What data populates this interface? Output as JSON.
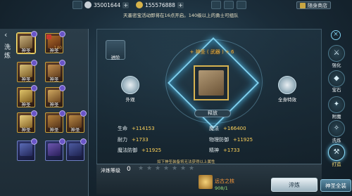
{
  "topbar": {
    "currency1": "35001644",
    "currency2": "155576888",
    "shop_label": "随身商店",
    "marquee": "天墨密宝活动即将在16点开启。140级以上的勇士可组队"
  },
  "left_panel": {
    "label": "洗炼",
    "items": [
      {
        "label": "神圣",
        "count": "",
        "type": "gold"
      },
      {
        "label": "神圣",
        "count": "140",
        "type": "gold"
      },
      {
        "label": "神圣",
        "count": "",
        "type": "gold"
      },
      {
        "label": "神圣",
        "count": "",
        "type": "gold"
      },
      {
        "label": "神圣",
        "count": "",
        "type": "gold"
      },
      {
        "label": "神圣",
        "count": "",
        "type": "gold"
      },
      {
        "label": "神圣",
        "count": "",
        "type": "gold"
      },
      {
        "label": "神圣",
        "count": "",
        "type": "gold"
      },
      {
        "label": "神圣",
        "count": "",
        "type": "gold"
      },
      {
        "label": "",
        "count": "",
        "type": "blue"
      },
      {
        "label": "",
        "count": "",
        "type": "blue"
      },
      {
        "label": "",
        "count": "",
        "type": "blue"
      }
    ]
  },
  "main": {
    "upgrade_label": "进阶",
    "title": "+ 神圣 ( 武器 ) + 6",
    "appearance_label": "外观",
    "fullbody_label": "全身特效",
    "release_label": "释放",
    "stats": [
      {
        "name": "生命",
        "value": "+114153"
      },
      {
        "name": "魔法",
        "value": "+166400"
      },
      {
        "name": "耐力",
        "value": "+1733"
      },
      {
        "name": "物理防御",
        "value": "+11925"
      },
      {
        "name": "魔法防御",
        "value": "+11925"
      },
      {
        "name": "精神",
        "value": "+1733"
      }
    ],
    "hint": "如下神圣装备将无法获得以上属性"
  },
  "bottom": {
    "level_label": "淬炼等级",
    "level_value": "0",
    "core_name": "远古之核",
    "core_count": "908/1",
    "refine_button": "淬炼",
    "gold_button": "神圣全装"
  },
  "right_tabs": [
    {
      "label": "强化",
      "active": false
    },
    {
      "label": "宝石",
      "active": false
    },
    {
      "label": "附魔",
      "active": false
    },
    {
      "label": "洗炼",
      "active": false
    },
    {
      "label": "打造",
      "active": true
    }
  ]
}
